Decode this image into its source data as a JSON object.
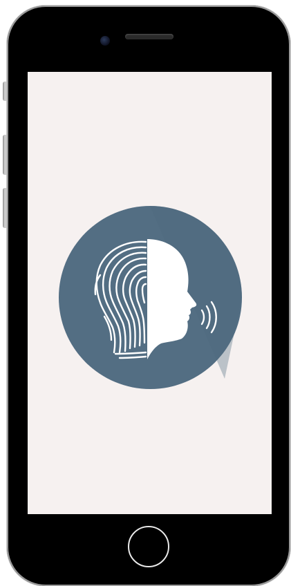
{
  "device": {
    "model": "iphone",
    "screen_background": "#f6f1f0",
    "frame_color": "#000000"
  },
  "app": {
    "logo_icon": "fingerprint-face-voice-icon",
    "logo_colors": {
      "circle": "#536e83",
      "shade": "#4b6579",
      "foreground": "#ffffff"
    }
  }
}
